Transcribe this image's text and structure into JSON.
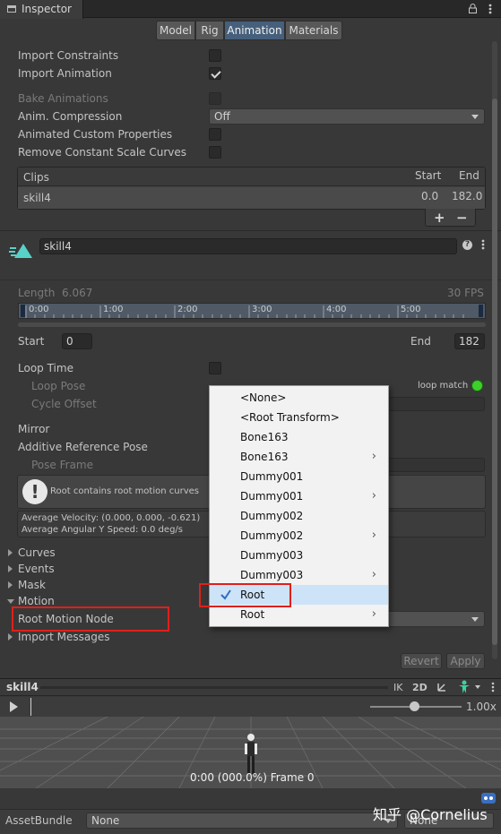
{
  "header": {
    "title": "Inspector"
  },
  "tabs": [
    "Model",
    "Rig",
    "Animation",
    "Materials"
  ],
  "options": {
    "import_constraints": "Import Constraints",
    "import_animation": "Import Animation",
    "bake_animations": "Bake Animations",
    "anim_compression": "Anim. Compression",
    "anim_compression_value": "Off",
    "animated_custom_props": "Animated Custom Properties",
    "remove_scale_curves": "Remove Constant Scale Curves"
  },
  "clips": {
    "header": "Clips",
    "start_header": "Start",
    "end_header": "End",
    "row": {
      "name": "skill4",
      "start": "0.0",
      "end": "182.0"
    },
    "plus": "+",
    "minus": "−"
  },
  "clip_name": "skill4",
  "timeline": {
    "length_label": "Length",
    "length_value": "6.067",
    "fps": "30 FPS",
    "ticks": [
      "0:00",
      "1:00",
      "2:00",
      "3:00",
      "4:00",
      "5:00"
    ]
  },
  "range": {
    "start_label": "Start",
    "start_value": "0",
    "end_label": "End",
    "end_value": "182"
  },
  "settings": {
    "loop_time": "Loop Time",
    "loop_pose": "Loop Pose",
    "loop_match": "loop match",
    "cycle_offset": "Cycle Offset",
    "mirror": "Mirror",
    "additive_ref_pose": "Additive Reference Pose",
    "pose_frame": "Pose Frame"
  },
  "info": {
    "message": "Root contains root motion curves",
    "avg_velocity": "Average Velocity: (0.000, 0.000, -0.621)",
    "avg_angular": "Average Angular Y Speed: 0.0 deg/s"
  },
  "foldouts": {
    "curves": "Curves",
    "events": "Events",
    "mask": "Mask",
    "motion": "Motion",
    "root_motion_node": "Root Motion Node",
    "import_messages": "Import Messages"
  },
  "menu": [
    {
      "label": "<None>",
      "sub": false,
      "checked": false
    },
    {
      "label": "<Root Transform>",
      "sub": false,
      "checked": false
    },
    {
      "label": "Bone163",
      "sub": false,
      "checked": false
    },
    {
      "label": "Bone163",
      "sub": true,
      "checked": false
    },
    {
      "label": "Dummy001",
      "sub": false,
      "checked": false
    },
    {
      "label": "Dummy001",
      "sub": true,
      "checked": false
    },
    {
      "label": "Dummy002",
      "sub": false,
      "checked": false
    },
    {
      "label": "Dummy002",
      "sub": true,
      "checked": false
    },
    {
      "label": "Dummy003",
      "sub": false,
      "checked": false
    },
    {
      "label": "Dummy003",
      "sub": true,
      "checked": false
    },
    {
      "label": "Root",
      "sub": false,
      "checked": true
    },
    {
      "label": "Root",
      "sub": true,
      "checked": false
    }
  ],
  "actions": {
    "revert": "Revert",
    "apply": "Apply"
  },
  "preview": {
    "clip": "skill4",
    "ik": "IK",
    "mode_2d": "2D",
    "speed": "1.00x",
    "overlay": "0:00 (000.0%) Frame 0"
  },
  "asset_bundle": {
    "label": "AssetBundle",
    "value": "None",
    "variant": "None"
  },
  "watermark": "知乎 @Cornelius",
  "colors": {
    "panel": "#383838",
    "active_tab": "#46607c",
    "loop_match_dot": "#3ecf2a",
    "highlight_box": "#e0201a",
    "menu_selected": "#cde3f7"
  }
}
